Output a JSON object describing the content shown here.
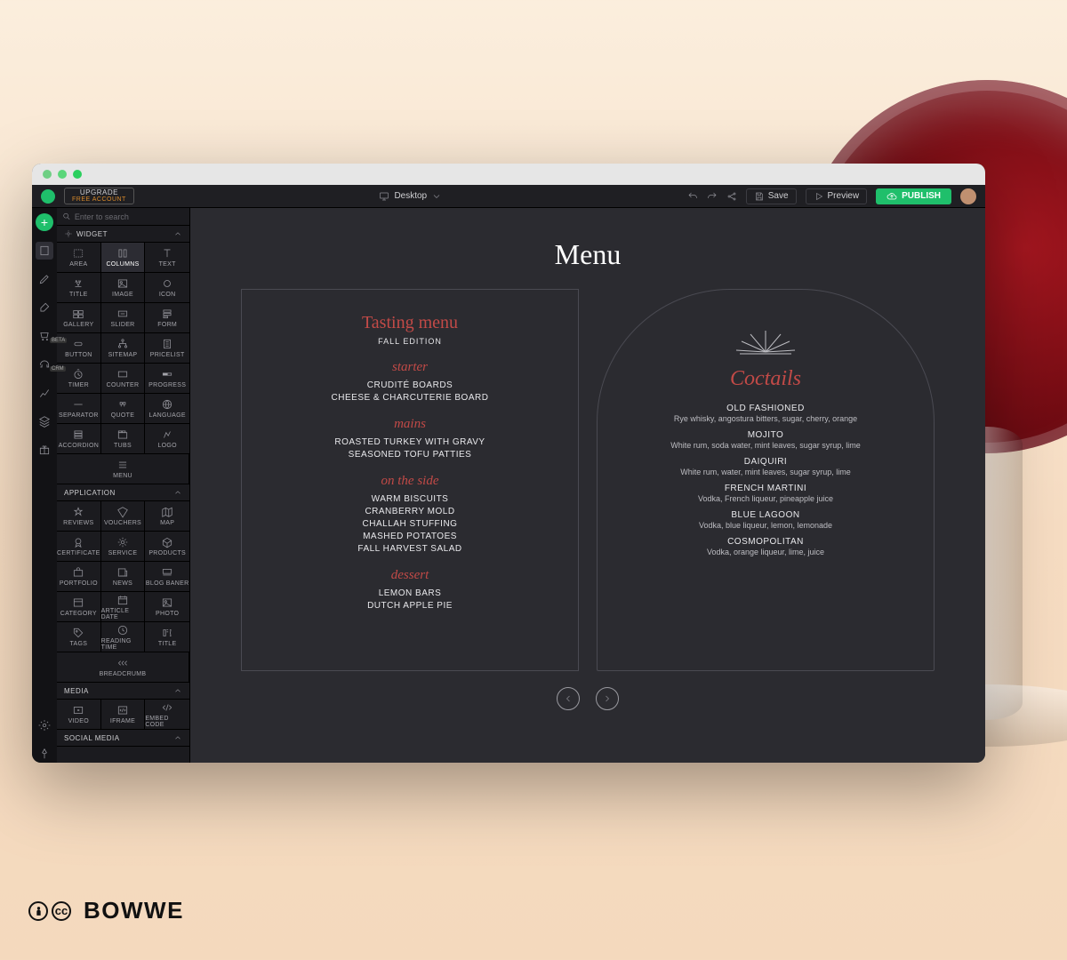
{
  "toolbar": {
    "upgrade_line1": "UPGRADE",
    "upgrade_line2": "FREE ACCOUNT",
    "device_label": "Desktop",
    "save_label": "Save",
    "preview_label": "Preview",
    "publish_label": "PUBLISH"
  },
  "search": {
    "placeholder": "Enter to search"
  },
  "sidebar_rail": {
    "beta_badge": "BETA",
    "crm_badge": "CRM"
  },
  "sections": {
    "widget": "WIDGET",
    "application": "APPLICATION",
    "media": "MEDIA",
    "social": "SOCIAL MEDIA"
  },
  "widgets": [
    {
      "id": "area",
      "label": "AREA"
    },
    {
      "id": "columns",
      "label": "COLUMNS",
      "selected": true
    },
    {
      "id": "text",
      "label": "TEXT"
    },
    {
      "id": "title",
      "label": "TITLE"
    },
    {
      "id": "image",
      "label": "IMAGE"
    },
    {
      "id": "icon",
      "label": "ICON"
    },
    {
      "id": "gallery",
      "label": "GALLERY"
    },
    {
      "id": "slider",
      "label": "SLIDER"
    },
    {
      "id": "form",
      "label": "FORM"
    },
    {
      "id": "button",
      "label": "BUTTON"
    },
    {
      "id": "sitemap",
      "label": "SITEMAP"
    },
    {
      "id": "pricelist",
      "label": "PRICELIST"
    },
    {
      "id": "timer",
      "label": "TIMER"
    },
    {
      "id": "counter",
      "label": "COUNTER"
    },
    {
      "id": "progress",
      "label": "PROGRESS"
    },
    {
      "id": "separator",
      "label": "SEPARATOR"
    },
    {
      "id": "quote",
      "label": "QUOTE"
    },
    {
      "id": "language",
      "label": "LANGUAGE"
    },
    {
      "id": "accordion",
      "label": "ACCORDION"
    },
    {
      "id": "tubs",
      "label": "TUBS"
    },
    {
      "id": "logo",
      "label": "LOGO"
    },
    {
      "id": "menu",
      "label": "MENU"
    }
  ],
  "applications": [
    {
      "id": "reviews",
      "label": "REVIEWS"
    },
    {
      "id": "vouchers",
      "label": "VOUCHERS"
    },
    {
      "id": "map",
      "label": "MAP"
    },
    {
      "id": "certificate",
      "label": "CERTIFICATE"
    },
    {
      "id": "service",
      "label": "SERVICE"
    },
    {
      "id": "products",
      "label": "PRODUCTS"
    },
    {
      "id": "portfolio",
      "label": "PORTFOLIO"
    },
    {
      "id": "news",
      "label": "NEWS"
    },
    {
      "id": "blog-baner",
      "label": "BLOG BANER"
    },
    {
      "id": "category",
      "label": "CATEGORY"
    },
    {
      "id": "article-date",
      "label": "ARTICLE DATE"
    },
    {
      "id": "photo",
      "label": "PHOTO"
    },
    {
      "id": "tags",
      "label": "TAGS"
    },
    {
      "id": "reading-time",
      "label": "READING TIME"
    },
    {
      "id": "title2",
      "label": "TITLE"
    },
    {
      "id": "breadcrumb",
      "label": "BREADCRUMB"
    }
  ],
  "media": [
    {
      "id": "video",
      "label": "VIDEO"
    },
    {
      "id": "iframe",
      "label": "IFRAME"
    },
    {
      "id": "embed-code",
      "label": "EMBED CODE"
    }
  ],
  "canvas": {
    "title": "Menu",
    "tasting": {
      "heading": "Tasting menu",
      "subtitle": "FALL EDITION",
      "groups": [
        {
          "name": "starter",
          "items": [
            "CRUDITÉ BOARDS",
            "CHEESE & CHARCUTERIE BOARD"
          ]
        },
        {
          "name": "mains",
          "items": [
            "ROASTED TURKEY WITH GRAVY",
            "SEASONED TOFU PATTIES"
          ]
        },
        {
          "name": "on the side",
          "items": [
            "WARM BISCUITS",
            "CRANBERRY MOLD",
            "CHALLAH STUFFING",
            "MASHED POTATOES",
            "FALL HARVEST SALAD"
          ]
        },
        {
          "name": "dessert",
          "items": [
            "LEMON BARS",
            "DUTCH APPLE PIE"
          ]
        }
      ]
    },
    "cocktails": {
      "heading": "Coctails",
      "items": [
        {
          "name": "OLD FASHIONED",
          "desc": "Rye whisky, angostura bitters, sugar, cherry, orange"
        },
        {
          "name": "MOJITO",
          "desc": "White rum, soda water, mint leaves, sugar syrup, lime"
        },
        {
          "name": "DAIQUIRI",
          "desc": "White rum, water, mint leaves, sugar syrup, lime"
        },
        {
          "name": "FRENCH MARTINI",
          "desc": "Vodka, French liqueur, pineapple juice"
        },
        {
          "name": "BLUE LAGOON",
          "desc": "Vodka, blue liqueur, lemon, lemonade"
        },
        {
          "name": "COSMOPOLITAN",
          "desc": "Vodka, orange liqueur, lime, juice"
        }
      ]
    }
  },
  "footer": {
    "brand": "BOWWE"
  }
}
